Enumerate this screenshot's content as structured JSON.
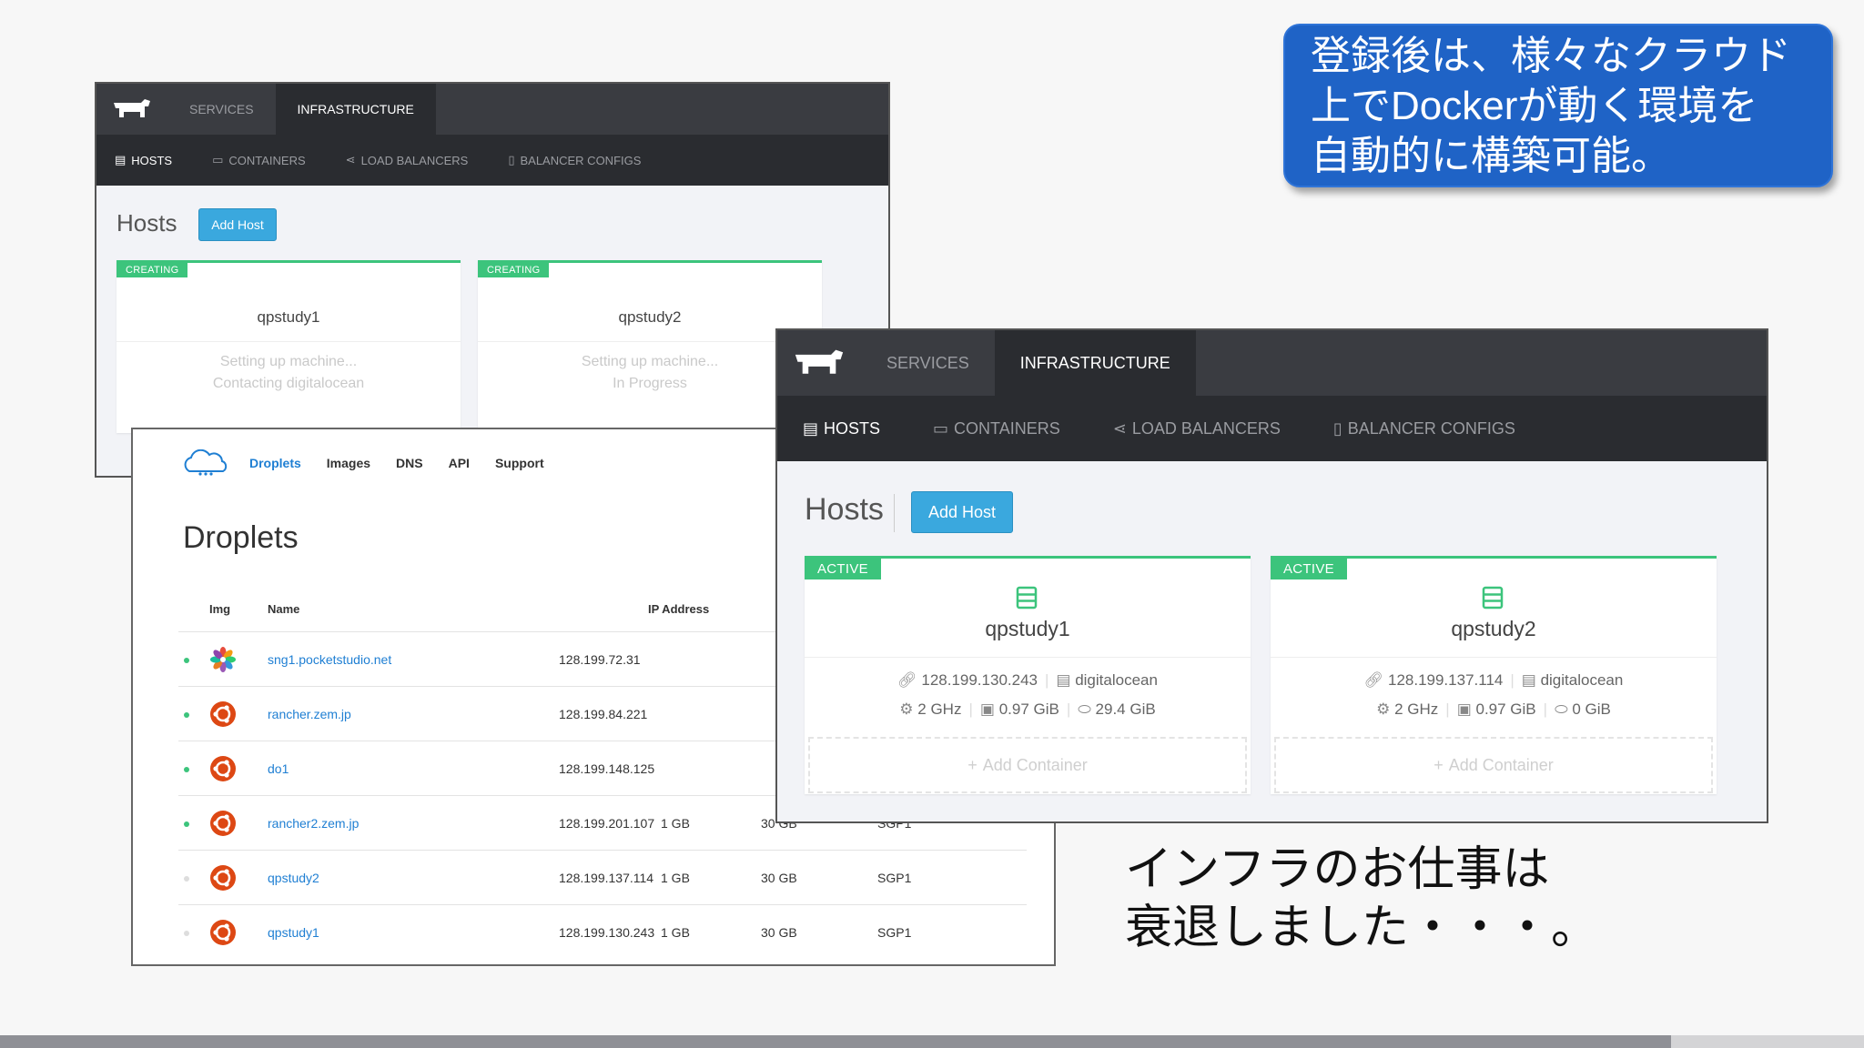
{
  "callout": {
    "text": "登録後は、様々なクラウド\n上でDockerが動く環境を\n自動的に構築可能。"
  },
  "caption": {
    "text": "インフラのお仕事は\n衰退しました・・・。"
  },
  "rancher_top": [
    "SERVICES",
    "INFRASTRUCTURE"
  ],
  "rancher_sub": [
    "HOSTS",
    "CONTAINERS",
    "LOAD BALANCERS",
    "BALANCER CONFIGS"
  ],
  "rancher_back": {
    "title": "Hosts",
    "add_host": "Add Host",
    "hosts": [
      {
        "state": "CREATING",
        "name": "qpstudy1",
        "line1": "Setting up machine...",
        "line2": "Contacting digitalocean"
      },
      {
        "state": "CREATING",
        "name": "qpstudy2",
        "line1": "Setting up machine...",
        "line2": "In Progress"
      }
    ]
  },
  "rancher_front": {
    "title": "Hosts",
    "add_host": "Add Host",
    "hosts": [
      {
        "state": "ACTIVE",
        "name": "qpstudy1",
        "ip": "128.199.130.243",
        "provider": "digitalocean",
        "cpu": "2 GHz",
        "mem": "0.97 GiB",
        "disk": "29.4 GiB",
        "add_container": "Add Container"
      },
      {
        "state": "ACTIVE",
        "name": "qpstudy2",
        "ip": "128.199.137.114",
        "provider": "digitalocean",
        "cpu": "2 GHz",
        "mem": "0.97 GiB",
        "disk": "0 GiB",
        "add_container": "Add Container"
      }
    ]
  },
  "digitalocean": {
    "nav": [
      "Droplets",
      "Images",
      "DNS",
      "API",
      "Support"
    ],
    "title": "Droplets",
    "headers": {
      "img": "Img",
      "name": "Name",
      "ip": "IP Address"
    },
    "rows": [
      {
        "name": "sng1.pocketstudio.net",
        "ip": "128.199.72.31",
        "mem": "",
        "disk": "",
        "region": "",
        "status": "on",
        "icon": "pinwheel-icon"
      },
      {
        "name": "rancher.zem.jp",
        "ip": "128.199.84.221",
        "mem": "",
        "disk": "",
        "region": "",
        "status": "on",
        "icon": "ubuntu-icon"
      },
      {
        "name": "do1",
        "ip": "128.199.148.125",
        "mem": "",
        "disk": "",
        "region": "",
        "status": "on",
        "icon": "ubuntu-icon"
      },
      {
        "name": "rancher2.zem.jp",
        "ip": "128.199.201.107",
        "mem": "1 GB",
        "disk": "30 GB",
        "region": "SGP1",
        "status": "on",
        "icon": "ubuntu-icon"
      },
      {
        "name": "qpstudy2",
        "ip": "128.199.137.114",
        "mem": "1 GB",
        "disk": "30 GB",
        "region": "SGP1",
        "status": "off",
        "icon": "ubuntu-icon"
      },
      {
        "name": "qpstudy1",
        "ip": "128.199.130.243",
        "mem": "1 GB",
        "disk": "30 GB",
        "region": "SGP1",
        "status": "off",
        "icon": "ubuntu-icon"
      }
    ]
  },
  "colors": {
    "accent": "#3aa8de",
    "active_green": "#3cc47c",
    "callout_blue": "#1f63c6",
    "ubuntu_orange": "#dd4814"
  }
}
